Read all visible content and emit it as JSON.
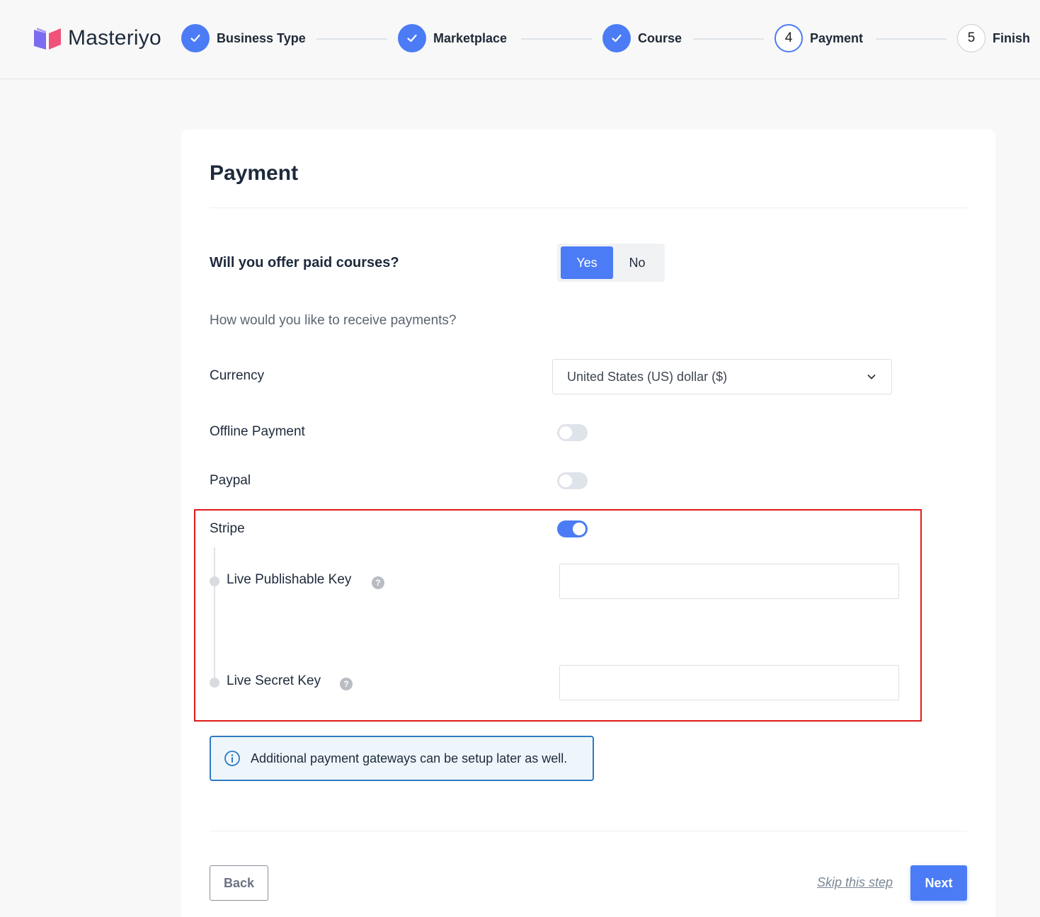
{
  "header": {
    "logo_text": "Masteriyo",
    "steps": [
      {
        "label": "Business Type",
        "state": "done",
        "number": "1"
      },
      {
        "label": "Marketplace",
        "state": "done",
        "number": "2"
      },
      {
        "label": "Course",
        "state": "done",
        "number": "3"
      },
      {
        "label": "Payment",
        "state": "active",
        "number": "4"
      },
      {
        "label": "Finish",
        "state": "todo",
        "number": "5"
      }
    ]
  },
  "page": {
    "title": "Payment",
    "paid_courses": {
      "question": "Will you offer paid courses?",
      "yes_label": "Yes",
      "no_label": "No",
      "selected": "Yes"
    },
    "receive_question": "How would you like to receive payments?",
    "currency": {
      "label": "Currency",
      "value": "United States (US) dollar ($)"
    },
    "offline_payment": {
      "label": "Offline Payment",
      "enabled": false
    },
    "paypal": {
      "label": "Paypal",
      "enabled": false
    },
    "stripe": {
      "label": "Stripe",
      "enabled": true,
      "publishable_key_label": "Live Publishable Key",
      "publishable_key_value": "",
      "secret_key_label": "Live Secret Key",
      "secret_key_value": "",
      "help_glyph": "?"
    },
    "info_text": "Additional payment gateways can be setup later as well.",
    "footer": {
      "back_label": "Back",
      "skip_label": "Skip this step",
      "next_label": "Next"
    }
  },
  "colors": {
    "accent": "#4b7cf5",
    "highlight_border": "#e01a1a",
    "info_border": "#2f7ac0"
  }
}
